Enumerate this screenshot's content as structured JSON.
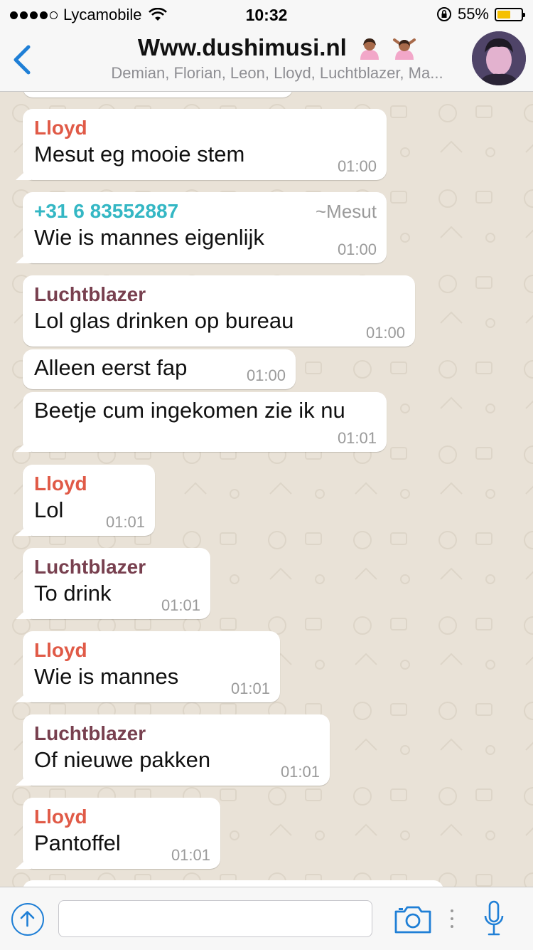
{
  "status_bar": {
    "carrier": "Lycamobile",
    "time": "10:32",
    "battery": "55%",
    "battery_level": 0.55
  },
  "header": {
    "title": "Www.dushimusi.nl",
    "subtitle": "Demian, Florian, Leon, Lloyd, Luchtblazer, Ma..."
  },
  "messages": [
    {
      "sender": "Lloyd",
      "text": "Mesut eg mooie stem",
      "time": "01:00"
    },
    {
      "sender": "+31 6 83552887",
      "alias": "~Mesut",
      "text": "Wie is mannes eigenlijk",
      "time": "01:00"
    },
    {
      "sender": "Luchtblazer",
      "text": "Lol glas drinken op bureau",
      "time": "01:00"
    },
    {
      "text": "Alleen eerst fap",
      "time": "01:00"
    },
    {
      "text": "Beetje cum ingekomen zie ik nu",
      "time": "01:01"
    },
    {
      "sender": "Lloyd",
      "text": "Lol",
      "time": "01:01"
    },
    {
      "sender": "Luchtblazer",
      "text": "To drink",
      "time": "01:01"
    },
    {
      "sender": "Lloyd",
      "text": "Wie is mannes",
      "time": "01:01"
    },
    {
      "sender": "Luchtblazer",
      "text": "Of nieuwe pakken",
      "time": "01:01"
    },
    {
      "sender": "Lloyd",
      "text": "Pantoffel",
      "time": "01:01"
    }
  ],
  "input_bar": {
    "placeholder": ""
  },
  "colors": {
    "accent": "#1f7fd6",
    "lloyd": "#e05a47",
    "luchtblazer": "#78404f",
    "phone_contact": "#34b7c4",
    "battery": "#f5c000"
  }
}
